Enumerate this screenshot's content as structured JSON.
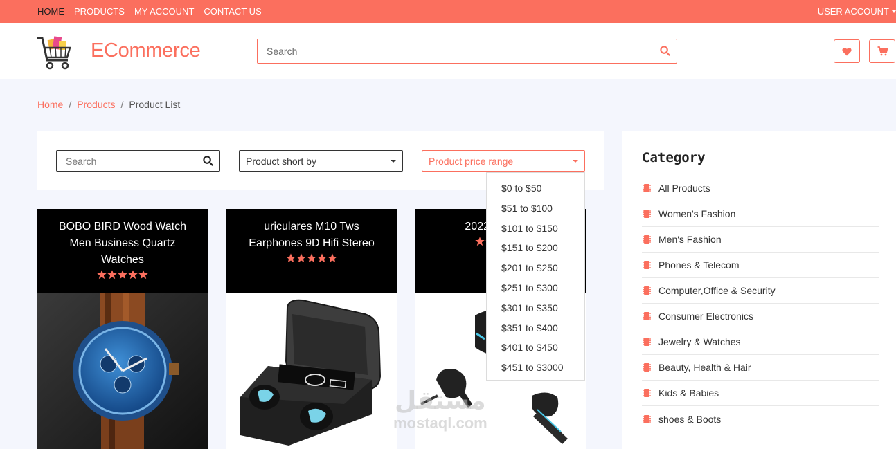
{
  "topbar": {
    "nav": [
      "HOME",
      "PRODUCTS",
      "MY ACCOUNT",
      "CONTACT US"
    ],
    "user_account": "USER ACCOUNT",
    "color": "#fb6f5e"
  },
  "header": {
    "brand": "ECommerce",
    "search_placeholder": "Search"
  },
  "breadcrumb": {
    "home": "Home",
    "products": "Products",
    "current": "Product List",
    "sep": "/"
  },
  "filters": {
    "search_placeholder": "Search",
    "sort_label": "Product short by",
    "price_label": "Product price range",
    "price_options": [
      "$0 to $50",
      "$51 to $100",
      "$101 to $150",
      "$151 to $200",
      "$201 to $250",
      "$251 to $300",
      "$301 to $350",
      "$351 to $400",
      "$401 to $450",
      "$451 to $3000"
    ]
  },
  "products": [
    {
      "title": "BOBO BIRD Wood Watch Men Business Quartz Watches",
      "rating": 5
    },
    {
      "title": "uriculares M10 Tws Earphones 9D Hifi Stereo",
      "rating": 5
    },
    {
      "title": "2022 Ba hotsa",
      "rating": 5
    }
  ],
  "category": {
    "title": "Category",
    "items": [
      "All Products",
      "Women's Fashion",
      "Men's Fashion",
      "Phones & Telecom",
      "Computer,Office & Security",
      "Consumer Electronics",
      "Jewelry & Watches",
      "Beauty, Health & Hair",
      "Kids & Babies",
      "shoes & Boots"
    ]
  },
  "watermark": {
    "arabic": "مستقل",
    "latin": "mostaql.com"
  }
}
